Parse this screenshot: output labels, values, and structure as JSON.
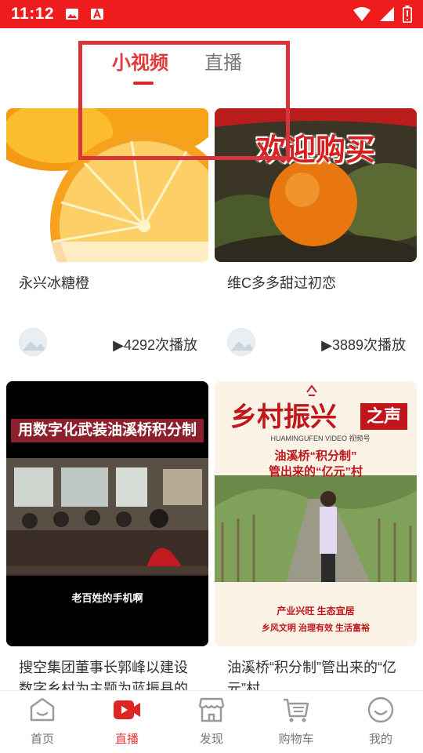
{
  "status_bar": {
    "time": "11:12",
    "icons": [
      "image-icon",
      "a-icon",
      "wifi-icon",
      "signal-icon",
      "battery-icon"
    ]
  },
  "tabs": [
    {
      "label": "小视频",
      "active": true
    },
    {
      "label": "直播",
      "active": false
    }
  ],
  "videos": [
    {
      "title": "永兴冰糖橙",
      "plays": "▶4292次播放",
      "thumb": "oranges-slices"
    },
    {
      "title": "维C多多甜过初恋",
      "plays": "▶3889次播放",
      "thumb": "orange-on-tree",
      "overlay_text": "欢迎购买"
    },
    {
      "title": "搜空集团董事长郭峰以建设数字乡村为主题为蓝振县的",
      "thumb": "meeting-room",
      "overlay_text": "用数字化武装油溪桥积分制",
      "caption": "老百姓的手机啊"
    },
    {
      "title": "油溪桥“积分制”管出来的“亿元”村",
      "thumb": "village-poster",
      "poster": {
        "heading": "乡村振兴",
        "badge": "之声",
        "brand": "HUAMINGUFEN VIDEO 视频号",
        "subtitle_line1": "油溪桥“积分制”",
        "subtitle_line2": "管出来的“亿元”村",
        "slogan1": "产业兴旺  生态宜居",
        "slogan2": "乡风文明  治理有效  生活富裕"
      }
    }
  ],
  "bottom_nav": [
    {
      "label": "首页",
      "icon": "home-icon",
      "active": false
    },
    {
      "label": "直播",
      "icon": "video-camera-icon",
      "active": true
    },
    {
      "label": "发现",
      "icon": "store-icon",
      "active": false
    },
    {
      "label": "购物车",
      "icon": "cart-icon",
      "active": false
    },
    {
      "label": "我的",
      "icon": "smiley-icon",
      "active": false
    }
  ],
  "colors": {
    "brand_red": "#ee1c1c",
    "active_tab": "#e23a3a",
    "inactive": "#777777"
  }
}
